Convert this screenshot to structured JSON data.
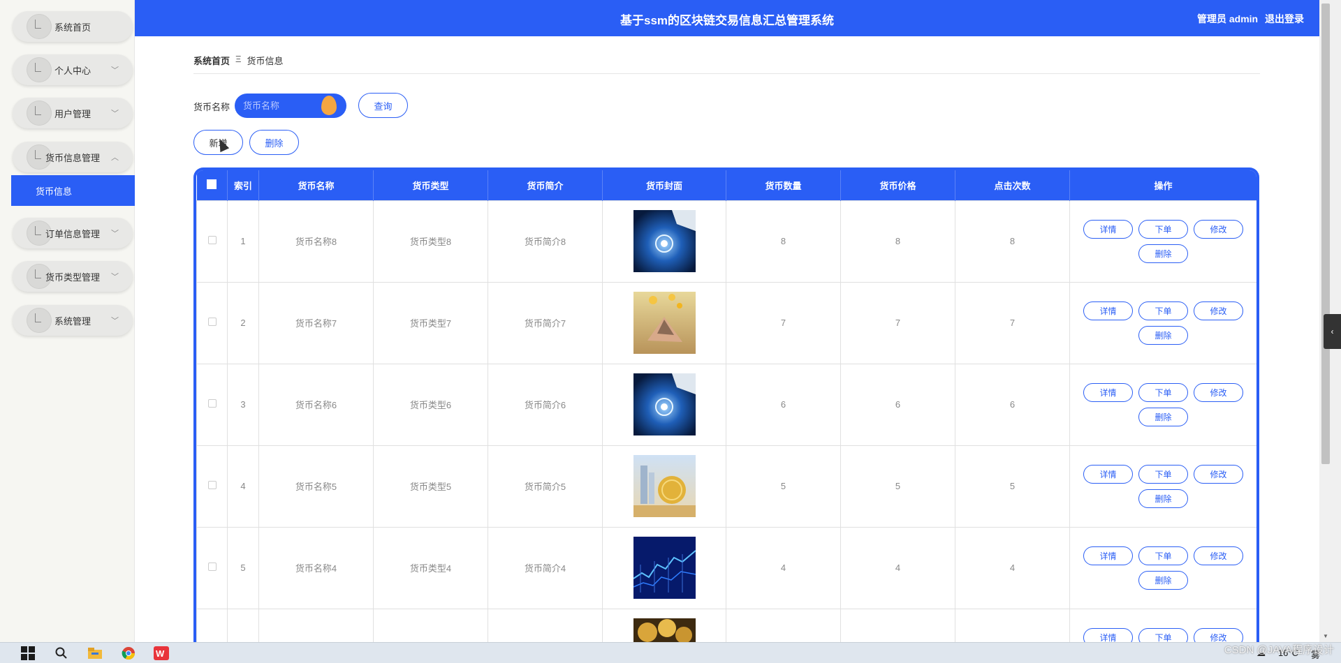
{
  "app": {
    "title": "基于ssm的区块链交易信息汇总管理系统",
    "user_label": "管理员 admin",
    "logout_label": "退出登录"
  },
  "sidebar": {
    "items": [
      {
        "label": "系统首页",
        "has_submenu": false
      },
      {
        "label": "个人中心",
        "has_submenu": true
      },
      {
        "label": "用户管理",
        "has_submenu": true
      },
      {
        "label": "货币信息管理",
        "has_submenu": true,
        "expanded": true
      },
      {
        "label": "订单信息管理",
        "has_submenu": true
      },
      {
        "label": "货币类型管理",
        "has_submenu": true
      },
      {
        "label": "系统管理",
        "has_submenu": true
      }
    ],
    "active_sub": "货币信息"
  },
  "breadcrumb": {
    "home": "系统首页",
    "separator": "Ξ",
    "current": "货币信息"
  },
  "search": {
    "label": "货币名称",
    "placeholder": "货币名称",
    "value": "",
    "query_label": "查询"
  },
  "actions": {
    "add_label": "新增",
    "delete_label": "删除"
  },
  "table": {
    "headers": [
      "索引",
      "货币名称",
      "货币类型",
      "货币简介",
      "货币封面",
      "货币数量",
      "货币价格",
      "点击次数",
      "操作"
    ],
    "rows": [
      {
        "index": "1",
        "name": "货币名称8",
        "type": "货币类型8",
        "intro": "货币简介8",
        "cover": "blockchain-hand",
        "qty": "8",
        "price": "8",
        "clicks": "8"
      },
      {
        "index": "2",
        "name": "货币名称7",
        "type": "货币类型7",
        "intro": "货币简介7",
        "cover": "handshake-coins",
        "qty": "7",
        "price": "7",
        "clicks": "7"
      },
      {
        "index": "3",
        "name": "货币名称6",
        "type": "货币类型6",
        "intro": "货币简介6",
        "cover": "blockchain-hand",
        "qty": "6",
        "price": "6",
        "clicks": "6"
      },
      {
        "index": "4",
        "name": "货币名称5",
        "type": "货币类型5",
        "intro": "货币简介5",
        "cover": "city-globe",
        "qty": "5",
        "price": "5",
        "clicks": "5"
      },
      {
        "index": "5",
        "name": "货币名称4",
        "type": "货币类型4",
        "intro": "货币简介4",
        "cover": "blue-chart",
        "qty": "4",
        "price": "4",
        "clicks": "4"
      },
      {
        "index": "",
        "name": "",
        "type": "",
        "intro": "",
        "cover": "gold-coins",
        "qty": "",
        "price": "",
        "clicks": ""
      }
    ],
    "row_actions": [
      "详情",
      "下单",
      "修改",
      "删除"
    ]
  },
  "taskbar": {
    "weather": "16°C",
    "weather_desc": "雾",
    "watermark": "CSDN @JAVA程序设计"
  },
  "colors": {
    "primary": "#2a5ef5",
    "sidebar_bg": "#f6f6f2",
    "accent_orange": "#f4a642"
  }
}
